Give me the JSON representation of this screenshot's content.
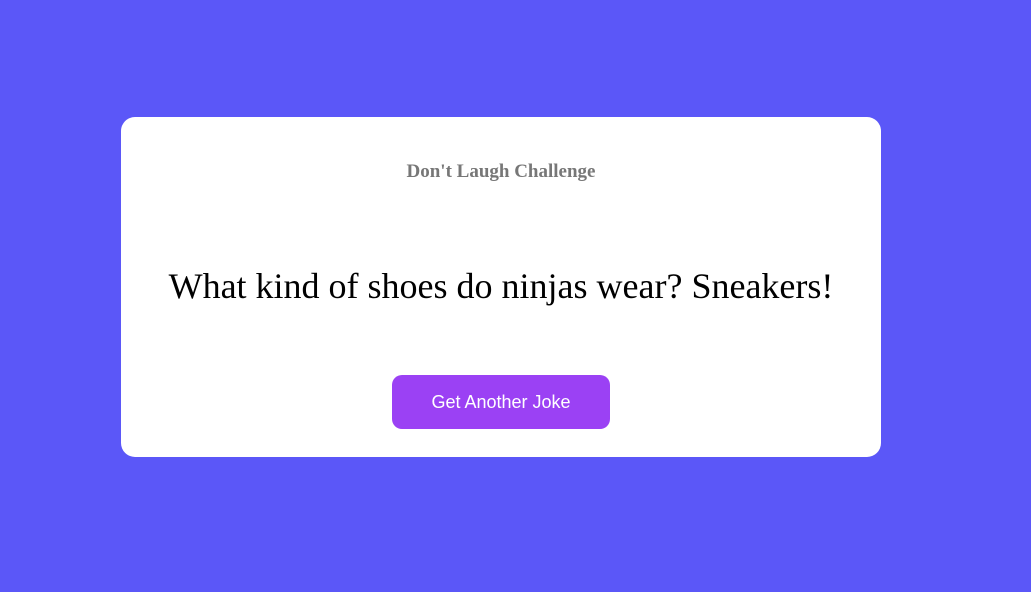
{
  "card": {
    "title": "Don't Laugh Challenge",
    "joke": "What kind of shoes do ninjas wear? Sneakers!",
    "button_label": "Get Another Joke"
  },
  "colors": {
    "background": "#5b57f8",
    "card": "#ffffff",
    "title": "#777777",
    "joke": "#000000",
    "button": "#9b41f4",
    "button_text": "#ffffff"
  }
}
